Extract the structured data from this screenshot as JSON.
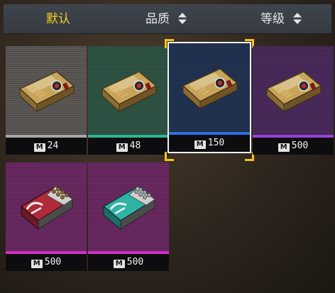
{
  "sort_bar": {
    "default_label": "默认",
    "quality_label": "品质",
    "grade_label": "等级",
    "active": "default",
    "active_color": "#f2d21e",
    "sort_icon": "sort-updown-icon"
  },
  "currency": {
    "icon_label": "M",
    "icon": "m-coin-icon"
  },
  "items": [
    {
      "kind": "ammo-box",
      "quality": "gray",
      "price": "24",
      "selected": false
    },
    {
      "kind": "ammo-box",
      "quality": "green",
      "price": "48",
      "selected": false
    },
    {
      "kind": "ammo-box",
      "quality": "blue",
      "price": "150",
      "selected": true
    },
    {
      "kind": "ammo-box",
      "quality": "purple",
      "price": "500",
      "selected": false
    },
    {
      "kind": "red-shell-box",
      "quality": "pink",
      "price": "500",
      "selected": false
    },
    {
      "kind": "teal-shell-box",
      "quality": "pink",
      "price": "500",
      "selected": false
    }
  ],
  "quality_colors": {
    "gray": "#a7a7a7",
    "green": "#2eb592",
    "blue": "#2d6fe3",
    "purple": "#9b43d8",
    "pink": "#d42fc6"
  }
}
